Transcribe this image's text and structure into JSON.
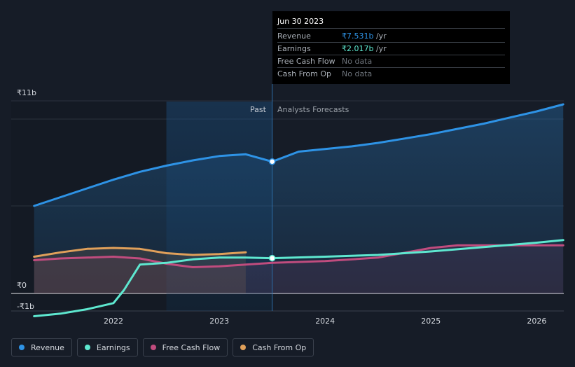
{
  "colors": {
    "revenue": "#2e93e6",
    "earnings": "#5ee8d0",
    "free_cash_flow": "#c04c7e",
    "cash_from_op": "#e0a05a",
    "background": "#161c27",
    "past_shade": "#0f1319",
    "highlight": "#1a3a5c"
  },
  "tooltip": {
    "date": "Jun 30 2023",
    "rows": [
      {
        "name": "Revenue",
        "value": "₹7.531b",
        "unit": " /yr"
      },
      {
        "name": "Earnings",
        "value": "₹2.017b",
        "unit": " /yr"
      },
      {
        "name": "Free Cash Flow",
        "value": "No data",
        "unit": ""
      },
      {
        "name": "Cash From Op",
        "value": "No data",
        "unit": ""
      }
    ]
  },
  "region_labels": {
    "past": "Past",
    "forecast": "Analysts Forecasts"
  },
  "legend": [
    {
      "label": "Revenue",
      "color_key": "revenue"
    },
    {
      "label": "Earnings",
      "color_key": "earnings"
    },
    {
      "label": "Free Cash Flow",
      "color_key": "free_cash_flow"
    },
    {
      "label": "Cash From Op",
      "color_key": "cash_from_op"
    }
  ],
  "chart_data": {
    "type": "line",
    "y_tick_labels": [
      "₹11b",
      "₹0",
      "-₹1b"
    ],
    "y_ticks": [
      11,
      0,
      -1
    ],
    "x_tick_labels": [
      "2022",
      "2023",
      "2024",
      "2025",
      "2026"
    ],
    "x_ticks": [
      2022,
      2023,
      2024,
      2025,
      2026
    ],
    "xlim": [
      2021.1,
      2026.25
    ],
    "ylim": [
      -1,
      11
    ],
    "past_region": [
      2022.5,
      2023.5
    ],
    "highlight_x": 2023.5,
    "series": [
      {
        "name": "Revenue",
        "color_key": "revenue",
        "x": [
          2021.25,
          2021.5,
          2021.75,
          2022.0,
          2022.25,
          2022.5,
          2022.75,
          2023.0,
          2023.25,
          2023.5,
          2023.75,
          2024.0,
          2024.25,
          2024.5,
          2024.75,
          2025.0,
          2025.25,
          2025.5,
          2025.75,
          2026.0,
          2026.25
        ],
        "y": [
          5.0,
          5.5,
          6.0,
          6.5,
          6.95,
          7.3,
          7.6,
          7.85,
          7.95,
          7.53,
          8.1,
          8.25,
          8.4,
          8.6,
          8.85,
          9.1,
          9.4,
          9.7,
          10.05,
          10.4,
          10.8
        ]
      },
      {
        "name": "Earnings",
        "color_key": "earnings",
        "x": [
          2021.25,
          2021.5,
          2021.75,
          2022.0,
          2022.1,
          2022.25,
          2022.5,
          2022.75,
          2023.0,
          2023.25,
          2023.5,
          2024.0,
          2024.5,
          2025.0,
          2025.5,
          2026.0,
          2026.25
        ],
        "y": [
          -1.3,
          -1.15,
          -0.9,
          -0.55,
          0.2,
          1.65,
          1.75,
          1.95,
          2.05,
          2.05,
          2.017,
          2.1,
          2.2,
          2.4,
          2.65,
          2.9,
          3.05
        ]
      },
      {
        "name": "Free Cash Flow",
        "color_key": "free_cash_flow",
        "x": [
          2021.25,
          2021.5,
          2021.75,
          2022.0,
          2022.25,
          2022.5,
          2022.75,
          2023.0,
          2023.25,
          2023.5,
          2024.0,
          2024.5,
          2025.0,
          2025.25,
          2025.5,
          2026.0,
          2026.25
        ],
        "y": [
          1.9,
          2.0,
          2.05,
          2.1,
          2.0,
          1.7,
          1.5,
          1.55,
          1.65,
          1.75,
          1.85,
          2.05,
          2.6,
          2.75,
          2.75,
          2.75,
          2.75
        ]
      },
      {
        "name": "Cash From Op",
        "color_key": "cash_from_op",
        "x": [
          2021.25,
          2021.5,
          2021.75,
          2022.0,
          2022.25,
          2022.5,
          2022.75,
          2023.0,
          2023.25
        ],
        "y": [
          2.1,
          2.35,
          2.55,
          2.6,
          2.55,
          2.3,
          2.2,
          2.25,
          2.35
        ]
      }
    ]
  }
}
